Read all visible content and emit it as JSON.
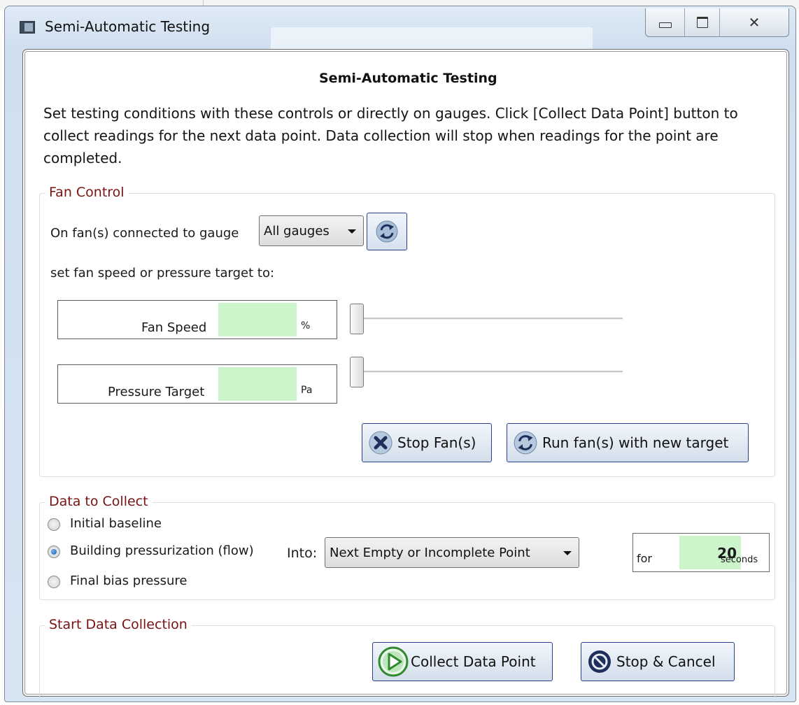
{
  "window": {
    "title": "Semi-Automatic Testing",
    "caption_minimize": "minimize",
    "caption_maximize": "maximize",
    "caption_close": "✕"
  },
  "dialog": {
    "heading": "Semi-Automatic Testing",
    "intro": "Set testing conditions with these controls or directly on gauges.  Click [Collect  Data Point] button to collect readings for the next data point.  Data collection  will stop when readings for the point are completed."
  },
  "fan_control": {
    "legend": "Fan Control",
    "gauge_label": "On fan(s) connected to gauge",
    "gauge_select": "All gauges",
    "target_label": "set fan speed or pressure target to:",
    "fan_speed": {
      "label": "Fan Speed",
      "value": "",
      "unit": "%",
      "slider_level": 0
    },
    "pressure_target": {
      "label": "Pressure Target",
      "value": "",
      "unit": "Pa",
      "slider_level": 0
    },
    "stop_button": "Stop Fan(s)",
    "run_button": "Run fan(s) with new target"
  },
  "data_to_collect": {
    "legend": "Data to Collect",
    "options": [
      {
        "label": "Initial baseline",
        "checked": false
      },
      {
        "label": "Building pressurization (flow)",
        "checked": true
      },
      {
        "label": "Final bias pressure",
        "checked": false
      }
    ],
    "into_label": "Into:",
    "into_select": "Next Empty or Incomplete Point",
    "for_label": "for",
    "seconds_value": "20",
    "seconds_label": "seconds"
  },
  "start_data_collection": {
    "legend": "Start Data Collection",
    "collect_button": "Collect Data Point",
    "cancel_button": "Stop & Cancel"
  },
  "icons": {
    "window": "window-app-icon",
    "refresh": "refresh-arrows-icon",
    "stop_x": "stop-x-icon",
    "run": "refresh-arrows-icon",
    "play": "play-icon",
    "cancel": "no-entry-icon"
  },
  "colors": {
    "legend_text": "#7a1212",
    "input_fill": "#ccf5cc",
    "button_border": "#2a3f8f"
  }
}
